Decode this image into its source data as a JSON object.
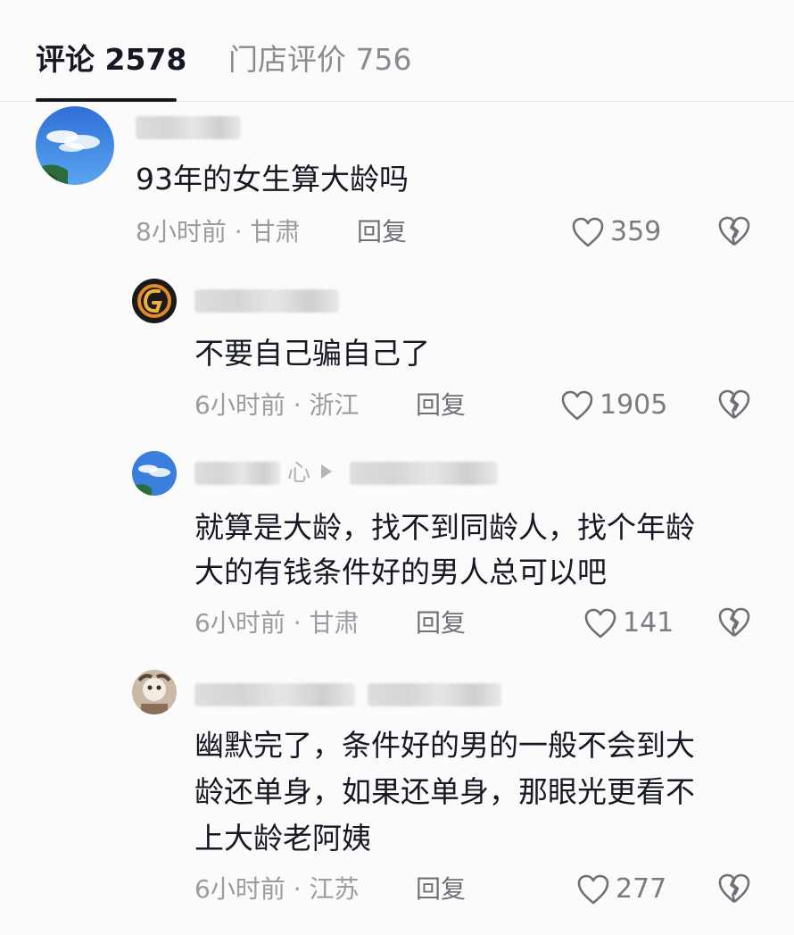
{
  "tabs": {
    "comments_label": "评论 2578",
    "store_reviews_label": "门店评价 756"
  },
  "comments": [
    {
      "text": "93年的女生算大龄吗",
      "meta": "8小时前 · 甘肃",
      "reply_label": "回复",
      "likes": "359"
    },
    {
      "text": "不要自己骗自己了",
      "meta": "6小时前 · 浙江",
      "reply_label": "回复",
      "likes": "1905"
    },
    {
      "username_visible": "心",
      "text_lines": [
        "就算是大龄，找不到同龄人，找个年龄",
        "大的有钱条件好的男人总可以吧"
      ],
      "meta": "6小时前 · 甘肃",
      "reply_label": "回复",
      "likes": "141"
    },
    {
      "text_lines": [
        "幽默完了，条件好的男的一般不会到大",
        "龄还单身，如果还单身，那眼光更看不",
        "上大龄老阿姨"
      ],
      "meta": "6小时前 · 江苏",
      "reply_label": "回复",
      "likes": "277"
    }
  ],
  "icons": {
    "like": "heart-outline-icon",
    "dislike": "broken-heart-icon"
  },
  "colors": {
    "text_primary": "#161823",
    "text_secondary": "#9b9ca1",
    "tab_inactive": "#8a8b91"
  }
}
